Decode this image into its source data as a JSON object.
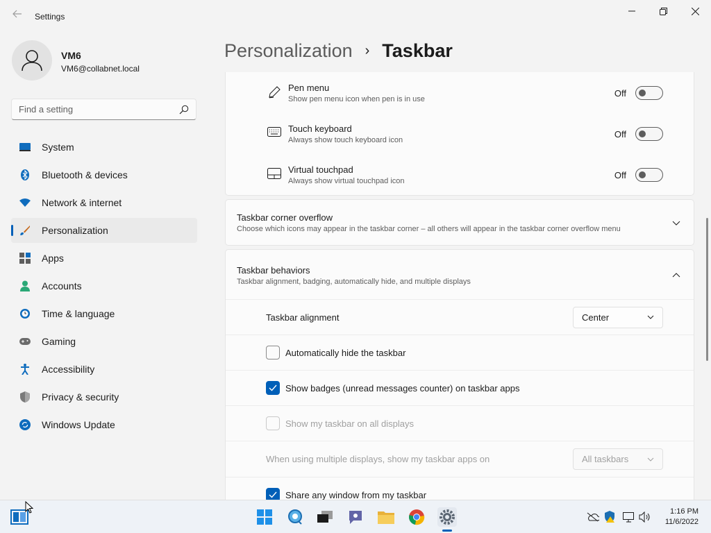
{
  "window": {
    "app_title": "Settings",
    "controls": [
      "minimize",
      "maximize",
      "close"
    ]
  },
  "user": {
    "name": "VM6",
    "email": "VM6@collabnet.local"
  },
  "search": {
    "placeholder": "Find a setting"
  },
  "sidebar": {
    "items": [
      {
        "label": "System",
        "icon": "monitor-icon",
        "active": false
      },
      {
        "label": "Bluetooth & devices",
        "icon": "bluetooth-icon",
        "active": false
      },
      {
        "label": "Network & internet",
        "icon": "wifi-icon",
        "active": false
      },
      {
        "label": "Personalization",
        "icon": "brush-icon",
        "active": true
      },
      {
        "label": "Apps",
        "icon": "apps-icon",
        "active": false
      },
      {
        "label": "Accounts",
        "icon": "person-icon",
        "active": false
      },
      {
        "label": "Time & language",
        "icon": "globe-clock-icon",
        "active": false
      },
      {
        "label": "Gaming",
        "icon": "gamepad-icon",
        "active": false
      },
      {
        "label": "Accessibility",
        "icon": "accessibility-icon",
        "active": false
      },
      {
        "label": "Privacy & security",
        "icon": "shield-icon",
        "active": false
      },
      {
        "label": "Windows Update",
        "icon": "update-icon",
        "active": false
      }
    ]
  },
  "breadcrumb": {
    "parent": "Personalization",
    "separator": "›",
    "current": "Taskbar"
  },
  "taskbar_items": {
    "pen_menu": {
      "title": "Pen menu",
      "desc": "Show pen menu icon when pen is in use",
      "state": "Off"
    },
    "touch_keyboard": {
      "title": "Touch keyboard",
      "desc": "Always show touch keyboard icon",
      "state": "Off"
    },
    "virtual_touchpad": {
      "title": "Virtual touchpad",
      "desc": "Always show virtual touchpad icon",
      "state": "Off"
    }
  },
  "corner_overflow": {
    "title": "Taskbar corner overflow",
    "desc": "Choose which icons may appear in the taskbar corner – all others will appear in the taskbar corner overflow menu"
  },
  "behaviors": {
    "title": "Taskbar behaviors",
    "desc": "Taskbar alignment, badging, automatically hide, and multiple displays",
    "alignment_label": "Taskbar alignment",
    "alignment_value": "Center",
    "auto_hide": {
      "label": "Automatically hide the taskbar",
      "checked": false,
      "disabled": false
    },
    "badges": {
      "label": "Show badges (unread messages counter) on taskbar apps",
      "checked": true,
      "disabled": false
    },
    "all_displays": {
      "label": "Show my taskbar on all displays",
      "checked": false,
      "disabled": true
    },
    "multi_display_label": "When using multiple displays, show my taskbar apps on",
    "multi_display_value": "All taskbars",
    "share_window": {
      "label": "Share any window from my taskbar",
      "checked": true,
      "disabled": false
    }
  },
  "taskbar": {
    "apps": [
      "windows-start-icon",
      "search-icon",
      "task-view-icon",
      "chat-icon",
      "file-explorer-icon",
      "chrome-icon",
      "settings-icon"
    ],
    "tray": [
      "onedrive-icon",
      "security-icon",
      "network-icon",
      "volume-icon"
    ],
    "time": "1:16 PM",
    "date": "11/6/2022"
  },
  "colors": {
    "accent": "#005fb8",
    "background": "#f3f3f3",
    "card": "#fbfbfb"
  }
}
